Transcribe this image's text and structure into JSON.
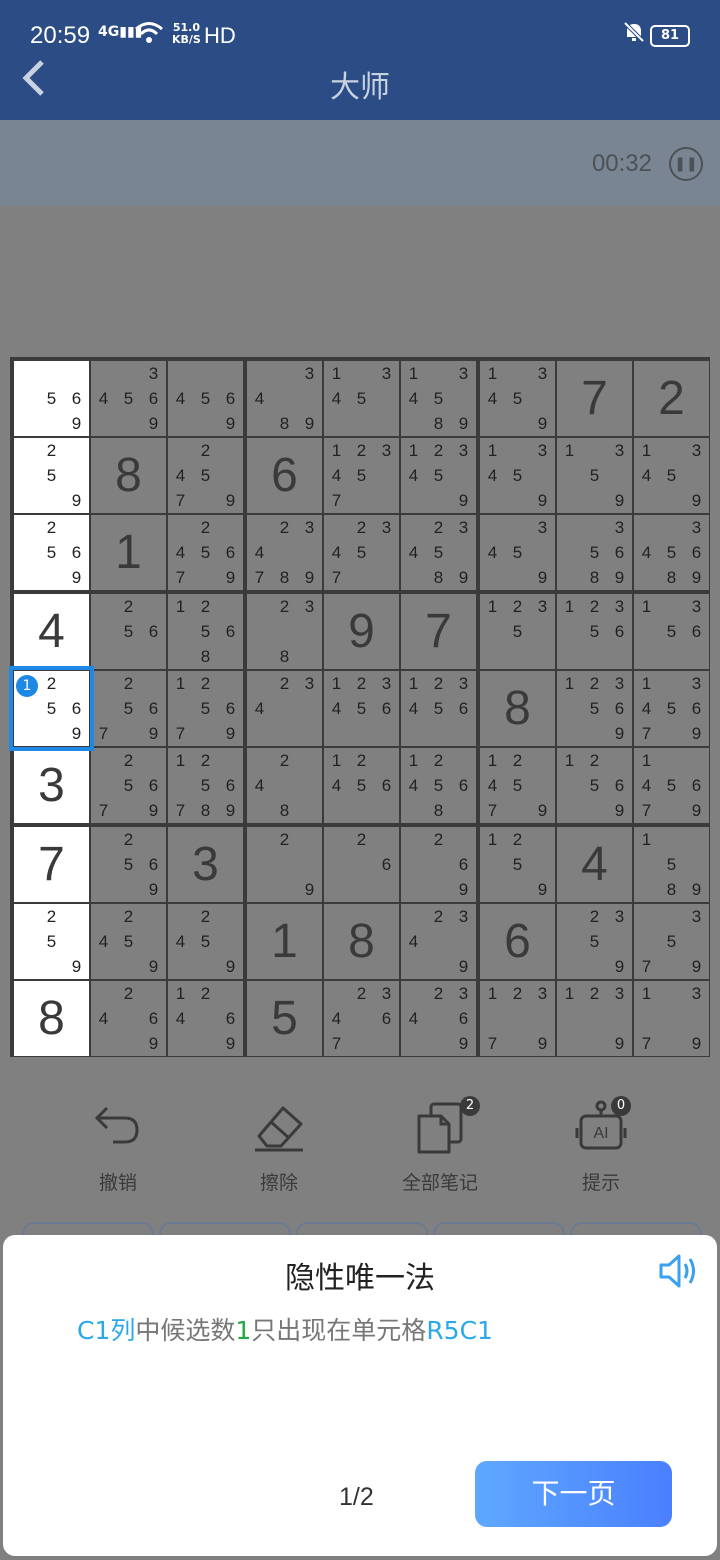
{
  "status_bar": {
    "time": "20:59",
    "signal": "4G",
    "net_speed_value": "51.0",
    "net_speed_unit": "KB/S",
    "hd": "HD",
    "battery": "81",
    "icons": [
      "signal-icon",
      "wifi-icon",
      "mute-bell-icon",
      "battery-icon"
    ]
  },
  "header": {
    "back_icon": "chevron-left-icon",
    "title": "大师"
  },
  "timer": {
    "value": "00:32",
    "pause_icon": "pause-icon"
  },
  "board": {
    "selected": {
      "row": 5,
      "col": 1,
      "badge": "1"
    },
    "white_column": 1,
    "rows": [
      [
        {
          "c": [
            5,
            6,
            9
          ]
        },
        {
          "c": [
            3,
            4,
            5,
            6,
            9
          ]
        },
        {
          "c": [
            4,
            5,
            6,
            9
          ]
        },
        {
          "c": [
            3,
            4,
            8,
            9
          ]
        },
        {
          "c": [
            1,
            3,
            4,
            5
          ]
        },
        {
          "c": [
            1,
            3,
            4,
            5,
            8,
            9
          ]
        },
        {
          "c": [
            1,
            3,
            4,
            5,
            9
          ]
        },
        {
          "v": 7
        },
        {
          "v": 2
        }
      ],
      [
        {
          "c": [
            2,
            5,
            9
          ]
        },
        {
          "v": 8
        },
        {
          "c": [
            2,
            4,
            5,
            7,
            9
          ]
        },
        {
          "v": 6
        },
        {
          "c": [
            1,
            2,
            3,
            4,
            5,
            7
          ]
        },
        {
          "c": [
            1,
            2,
            3,
            4,
            5,
            9
          ]
        },
        {
          "c": [
            1,
            3,
            4,
            5,
            9
          ]
        },
        {
          "c": [
            1,
            3,
            5,
            9
          ]
        },
        {
          "c": [
            1,
            3,
            4,
            5,
            9
          ]
        }
      ],
      [
        {
          "c": [
            2,
            5,
            6,
            9
          ]
        },
        {
          "v": 1
        },
        {
          "c": [
            2,
            4,
            5,
            6,
            7,
            9
          ]
        },
        {
          "c": [
            2,
            3,
            4,
            7,
            8,
            9
          ]
        },
        {
          "c": [
            2,
            3,
            4,
            5,
            7
          ]
        },
        {
          "c": [
            2,
            3,
            4,
            5,
            8,
            9
          ]
        },
        {
          "c": [
            3,
            4,
            5,
            9
          ]
        },
        {
          "c": [
            3,
            5,
            6,
            8,
            9
          ]
        },
        {
          "c": [
            3,
            4,
            5,
            6,
            8,
            9
          ]
        }
      ],
      [
        {
          "v": 4
        },
        {
          "c": [
            2,
            5,
            6
          ]
        },
        {
          "c": [
            1,
            2,
            5,
            6,
            8
          ]
        },
        {
          "c": [
            2,
            3,
            8
          ]
        },
        {
          "v": 9
        },
        {
          "v": 7
        },
        {
          "c": [
            1,
            2,
            3,
            5
          ]
        },
        {
          "c": [
            1,
            2,
            3,
            5,
            6
          ]
        },
        {
          "c": [
            1,
            3,
            5,
            6
          ]
        }
      ],
      [
        {
          "c": [
            2,
            5,
            6,
            9
          ]
        },
        {
          "c": [
            2,
            5,
            6,
            7,
            9
          ]
        },
        {
          "c": [
            1,
            2,
            5,
            6,
            7,
            9
          ]
        },
        {
          "c": [
            2,
            3,
            4
          ]
        },
        {
          "c": [
            1,
            2,
            3,
            4,
            5,
            6
          ]
        },
        {
          "c": [
            1,
            2,
            3,
            4,
            5,
            6
          ]
        },
        {
          "v": 8
        },
        {
          "c": [
            1,
            2,
            3,
            5,
            6,
            9
          ]
        },
        {
          "c": [
            1,
            3,
            4,
            5,
            6,
            7,
            9
          ]
        }
      ],
      [
        {
          "v": 3
        },
        {
          "c": [
            2,
            5,
            6,
            7,
            9
          ]
        },
        {
          "c": [
            1,
            2,
            5,
            6,
            7,
            8,
            9
          ]
        },
        {
          "c": [
            2,
            4,
            8
          ]
        },
        {
          "c": [
            1,
            2,
            4,
            5,
            6
          ]
        },
        {
          "c": [
            1,
            2,
            4,
            5,
            6,
            8
          ]
        },
        {
          "c": [
            1,
            2,
            4,
            5,
            7,
            9
          ]
        },
        {
          "c": [
            1,
            2,
            5,
            6,
            9
          ]
        },
        {
          "c": [
            1,
            4,
            5,
            6,
            7,
            9
          ]
        }
      ],
      [
        {
          "v": 7
        },
        {
          "c": [
            2,
            5,
            6,
            9
          ]
        },
        {
          "v": 3
        },
        {
          "c": [
            2,
            9
          ]
        },
        {
          "c": [
            2,
            6
          ]
        },
        {
          "c": [
            2,
            6,
            9
          ]
        },
        {
          "c": [
            1,
            2,
            5,
            9
          ]
        },
        {
          "v": 4
        },
        {
          "c": [
            1,
            5,
            8,
            9
          ]
        }
      ],
      [
        {
          "c": [
            2,
            5,
            9
          ]
        },
        {
          "c": [
            2,
            4,
            5,
            9
          ]
        },
        {
          "c": [
            2,
            4,
            5,
            9
          ]
        },
        {
          "v": 1
        },
        {
          "v": 8
        },
        {
          "c": [
            2,
            3,
            4,
            9
          ]
        },
        {
          "v": 6
        },
        {
          "c": [
            2,
            3,
            5,
            9
          ]
        },
        {
          "c": [
            3,
            5,
            7,
            9
          ]
        }
      ],
      [
        {
          "v": 8
        },
        {
          "c": [
            2,
            4,
            6,
            9
          ]
        },
        {
          "c": [
            1,
            2,
            4,
            6,
            9
          ]
        },
        {
          "v": 5
        },
        {
          "c": [
            2,
            3,
            4,
            6,
            7
          ]
        },
        {
          "c": [
            2,
            3,
            4,
            6,
            9
          ]
        },
        {
          "c": [
            1,
            2,
            3,
            7,
            9
          ]
        },
        {
          "c": [
            1,
            2,
            3,
            9
          ]
        },
        {
          "c": [
            1,
            3,
            7,
            9
          ]
        }
      ]
    ]
  },
  "toolbar": [
    {
      "label": "撤销",
      "icon": "undo-icon",
      "badge": null
    },
    {
      "label": "擦除",
      "icon": "eraser-icon",
      "badge": null
    },
    {
      "label": "全部笔记",
      "icon": "notes-icon",
      "badge": "2"
    },
    {
      "label": "提示",
      "icon": "ai-hint-icon",
      "badge": "0"
    }
  ],
  "hint_sheet": {
    "title": "隐性唯一法",
    "speaker_icon": "speaker-icon",
    "text_col": "C1列",
    "text_mid1": "中候选数",
    "text_num": "1",
    "text_mid2": "只出现在单元格",
    "text_cell": "R5C1",
    "page": "1/2",
    "next_label": "下一页"
  }
}
